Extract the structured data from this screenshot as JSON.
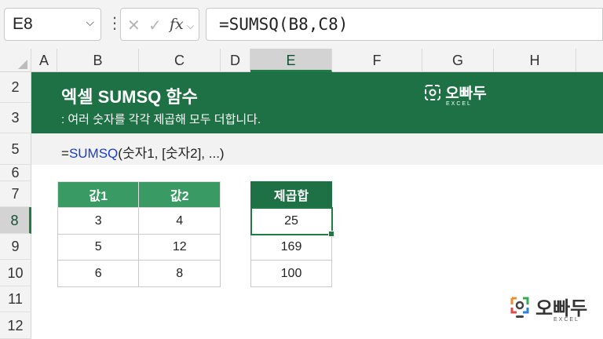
{
  "formula_bar": {
    "name_box": "E8",
    "formula": "=SUMSQ(B8,C8)",
    "cancel_glyph": "✕",
    "enter_glyph": "✓",
    "fx_label": "fx"
  },
  "columns": [
    "A",
    "B",
    "C",
    "D",
    "E",
    "F",
    "G",
    "H"
  ],
  "selected_column": "E",
  "rows": [
    "2",
    "3",
    "5",
    "6",
    "7",
    "8",
    "9",
    "10",
    "11",
    "12"
  ],
  "selected_row": "8",
  "banner": {
    "title": "엑셀 SUMSQ 함수",
    "subtitle": ": 여러 숫자를 각각 제곱해 모두 더합니다.",
    "brand": "오빠두",
    "brand_sub": "EXCEL"
  },
  "syntax": {
    "prefix": "=",
    "function": "SUMSQ",
    "args": "(숫자1, [숫자2], ...)"
  },
  "input_table": {
    "headers": [
      "값1",
      "값2"
    ],
    "rows": [
      [
        "3",
        "4"
      ],
      [
        "5",
        "12"
      ],
      [
        "6",
        "8"
      ]
    ]
  },
  "result_table": {
    "header": "제곱합",
    "values": [
      "25",
      "169",
      "100"
    ]
  },
  "colors": {
    "banner_green": "#1e7145",
    "header_green": "#3a9a63",
    "selection_green": "#1f7a45",
    "function_blue": "#1a3ec7"
  },
  "icons": [
    "chevron-down-icon",
    "more-icon",
    "cancel-icon",
    "enter-icon",
    "function-icon",
    "brand-logo-icon"
  ]
}
